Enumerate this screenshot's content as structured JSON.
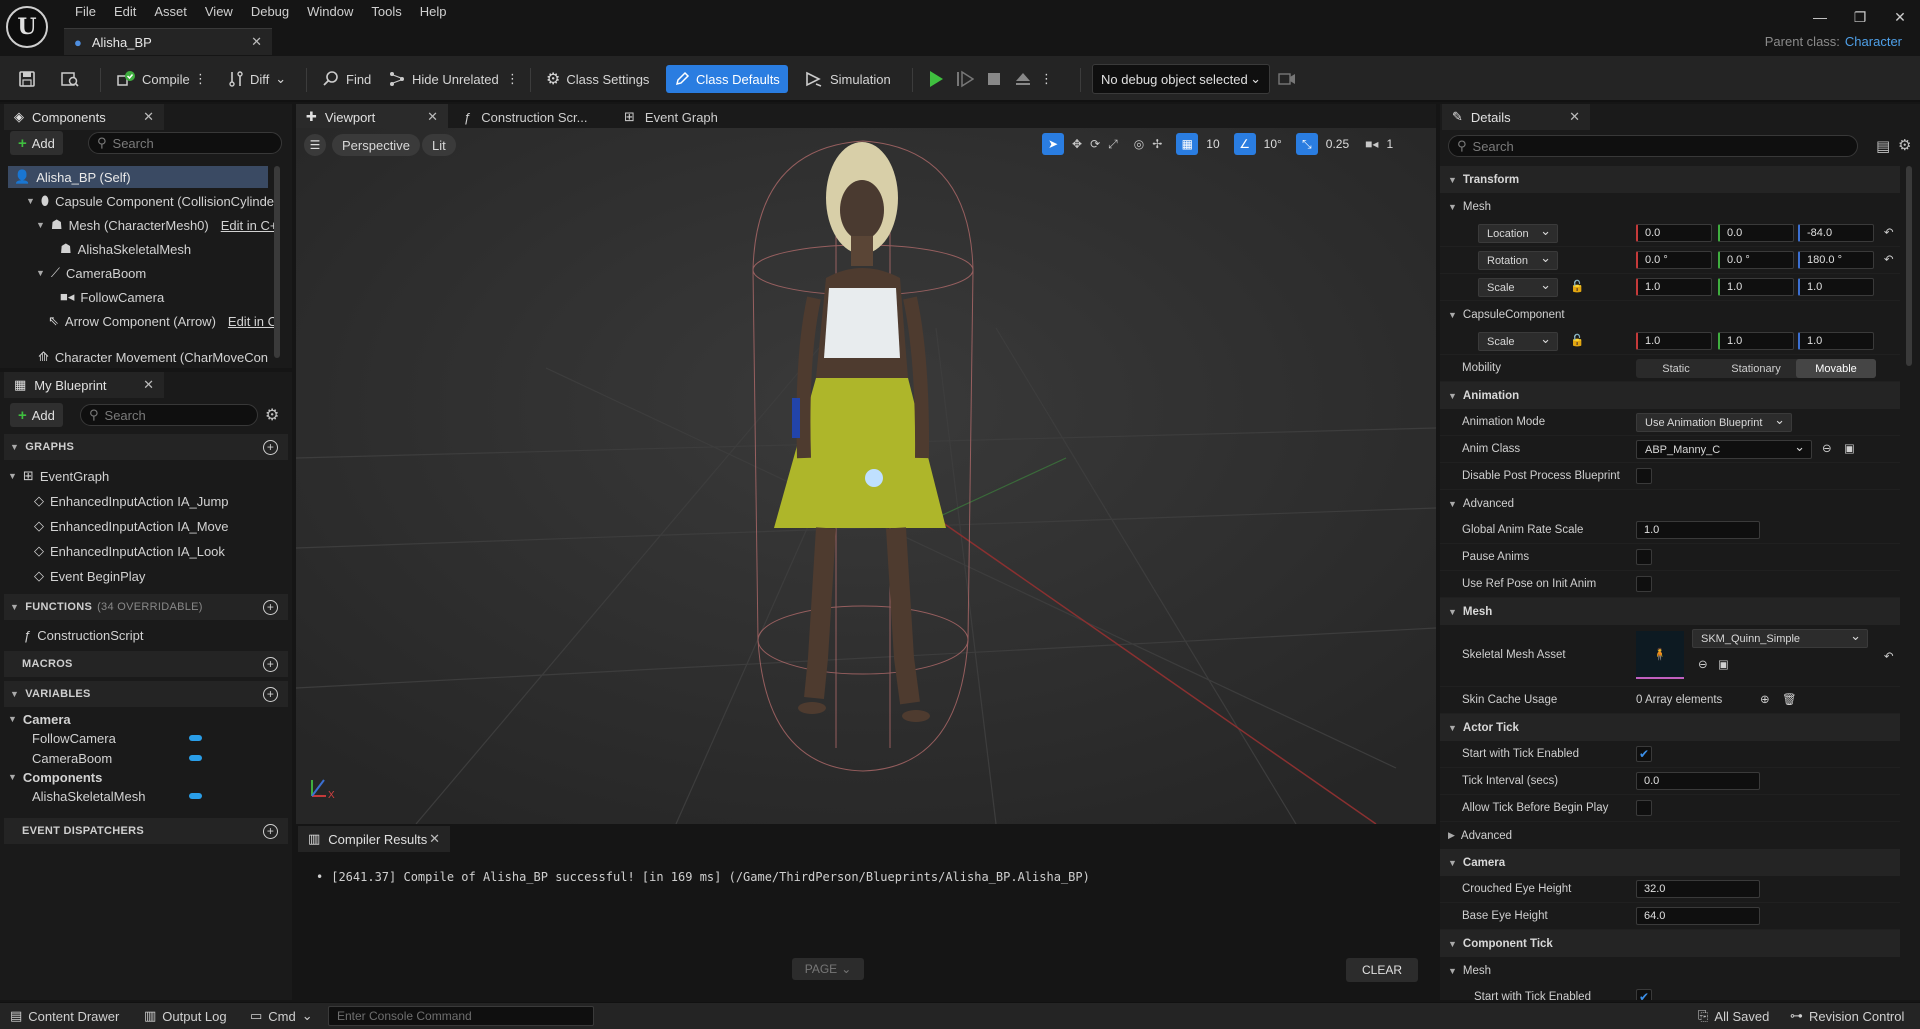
{
  "menu": [
    "File",
    "Edit",
    "Asset",
    "View",
    "Debug",
    "Window",
    "Tools",
    "Help"
  ],
  "doc_tab": {
    "title": "Alisha_BP"
  },
  "parent_class": {
    "label": "Parent class:",
    "value": "Character"
  },
  "toolbar": {
    "compile": "Compile",
    "diff": "Diff",
    "find": "Find",
    "hide_unrelated": "Hide Unrelated",
    "class_settings": "Class Settings",
    "class_defaults": "Class Defaults",
    "simulation": "Simulation",
    "debug_object": "No debug object selected"
  },
  "components": {
    "tab": "Components",
    "add": "Add",
    "search_placeholder": "Search",
    "items": [
      {
        "label": "Alisha_BP (Self)"
      },
      {
        "label": "Capsule Component (CollisionCylinde"
      },
      {
        "label": "Mesh (CharacterMesh0)",
        "link": "Edit in C+"
      },
      {
        "label": "AlishaSkeletalMesh"
      },
      {
        "label": "CameraBoom"
      },
      {
        "label": "FollowCamera"
      },
      {
        "label": "Arrow Component (Arrow)",
        "link": "Edit in C"
      },
      {
        "label": "Character Movement (CharMoveCon"
      }
    ]
  },
  "my_blueprint": {
    "tab": "My Blueprint",
    "add": "Add",
    "search_placeholder": "Search",
    "graphs_header": "GRAPHS",
    "event_graph": "EventGraph",
    "events": [
      "EnhancedInputAction IA_Jump",
      "EnhancedInputAction IA_Move",
      "EnhancedInputAction IA_Look",
      "Event BeginPlay"
    ],
    "functions_header": "FUNCTIONS",
    "functions_count": "(34 OVERRIDABLE)",
    "construction_script": "ConstructionScript",
    "macros_header": "MACROS",
    "variables_header": "VARIABLES",
    "var_groups": [
      {
        "name": "Camera",
        "vars": [
          "FollowCamera",
          "CameraBoom"
        ]
      },
      {
        "name": "Components",
        "vars": [
          "AlishaSkeletalMesh"
        ]
      }
    ],
    "dispatchers_header": "EVENT DISPATCHERS"
  },
  "editor_tabs": [
    "Viewport",
    "Construction Scr...",
    "Event Graph"
  ],
  "viewport": {
    "perspective": "Perspective",
    "lit": "Lit",
    "grid_snap": "10",
    "rot_snap": "10°",
    "scale_snap": "0.25",
    "camera_speed": "1",
    "axis_x": "X"
  },
  "compiler": {
    "tab": "Compiler Results",
    "message": "[2641.37] Compile of Alisha_BP successful! [in 169 ms] (/Game/ThirdPerson/Blueprints/Alisha_BP.Alisha_BP)",
    "page": "PAGE",
    "clear": "CLEAR"
  },
  "details": {
    "tab": "Details",
    "search_placeholder": "Search",
    "transform": "Transform",
    "mesh_sub": "Mesh",
    "location": {
      "label": "Location",
      "x": "0.0",
      "y": "0.0",
      "z": "-84.0"
    },
    "rotation": {
      "label": "Rotation",
      "x": "0.0 °",
      "y": "0.0 °",
      "z": "180.0 °"
    },
    "scale": {
      "label": "Scale",
      "x": "1.0",
      "y": "1.0",
      "z": "1.0"
    },
    "capsule_sub": "CapsuleComponent",
    "capsule_scale": {
      "label": "Scale",
      "x": "1.0",
      "y": "1.0",
      "z": "1.0"
    },
    "mobility": {
      "label": "Mobility",
      "options": [
        "Static",
        "Stationary",
        "Movable"
      ],
      "selected": "Movable"
    },
    "animation": "Animation",
    "anim_mode": {
      "label": "Animation Mode",
      "value": "Use Animation Blueprint"
    },
    "anim_class": {
      "label": "Anim Class",
      "value": "ABP_Manny_C"
    },
    "disable_ppb": "Disable Post Process Blueprint",
    "advanced": "Advanced",
    "global_rate": {
      "label": "Global Anim Rate Scale",
      "value": "1.0"
    },
    "pause_anims": "Pause Anims",
    "ref_pose": "Use Ref Pose on Init Anim",
    "mesh_section": "Mesh",
    "skel_mesh": {
      "label": "Skeletal Mesh Asset",
      "value": "SKM_Quinn_Simple"
    },
    "skin_cache": {
      "label": "Skin Cache Usage",
      "value": "0 Array elements"
    },
    "actor_tick": "Actor Tick",
    "start_tick": "Start with Tick Enabled",
    "tick_interval": {
      "label": "Tick Interval (secs)",
      "value": "0.0"
    },
    "allow_tick": "Allow Tick Before Begin Play",
    "advanced2": "Advanced",
    "camera": "Camera",
    "crouched_eye": {
      "label": "Crouched Eye Height",
      "value": "32.0"
    },
    "base_eye": {
      "label": "Base Eye Height",
      "value": "64.0"
    },
    "component_tick": "Component Tick",
    "ct_mesh": "Mesh",
    "ct_start": "Start with Tick Enabled"
  },
  "statusbar": {
    "content_drawer": "Content Drawer",
    "output_log": "Output Log",
    "cmd": "Cmd",
    "console_placeholder": "Enter Console Command",
    "all_saved": "All Saved",
    "revision": "Revision Control"
  },
  "colors": {
    "accent": "#2a7de1",
    "x_axis": "#c53a3a",
    "y_axis": "#3fae3f",
    "z_axis": "#3b6fd1",
    "var_pill": "#2a9ee8",
    "play": "#3fbf3f"
  }
}
